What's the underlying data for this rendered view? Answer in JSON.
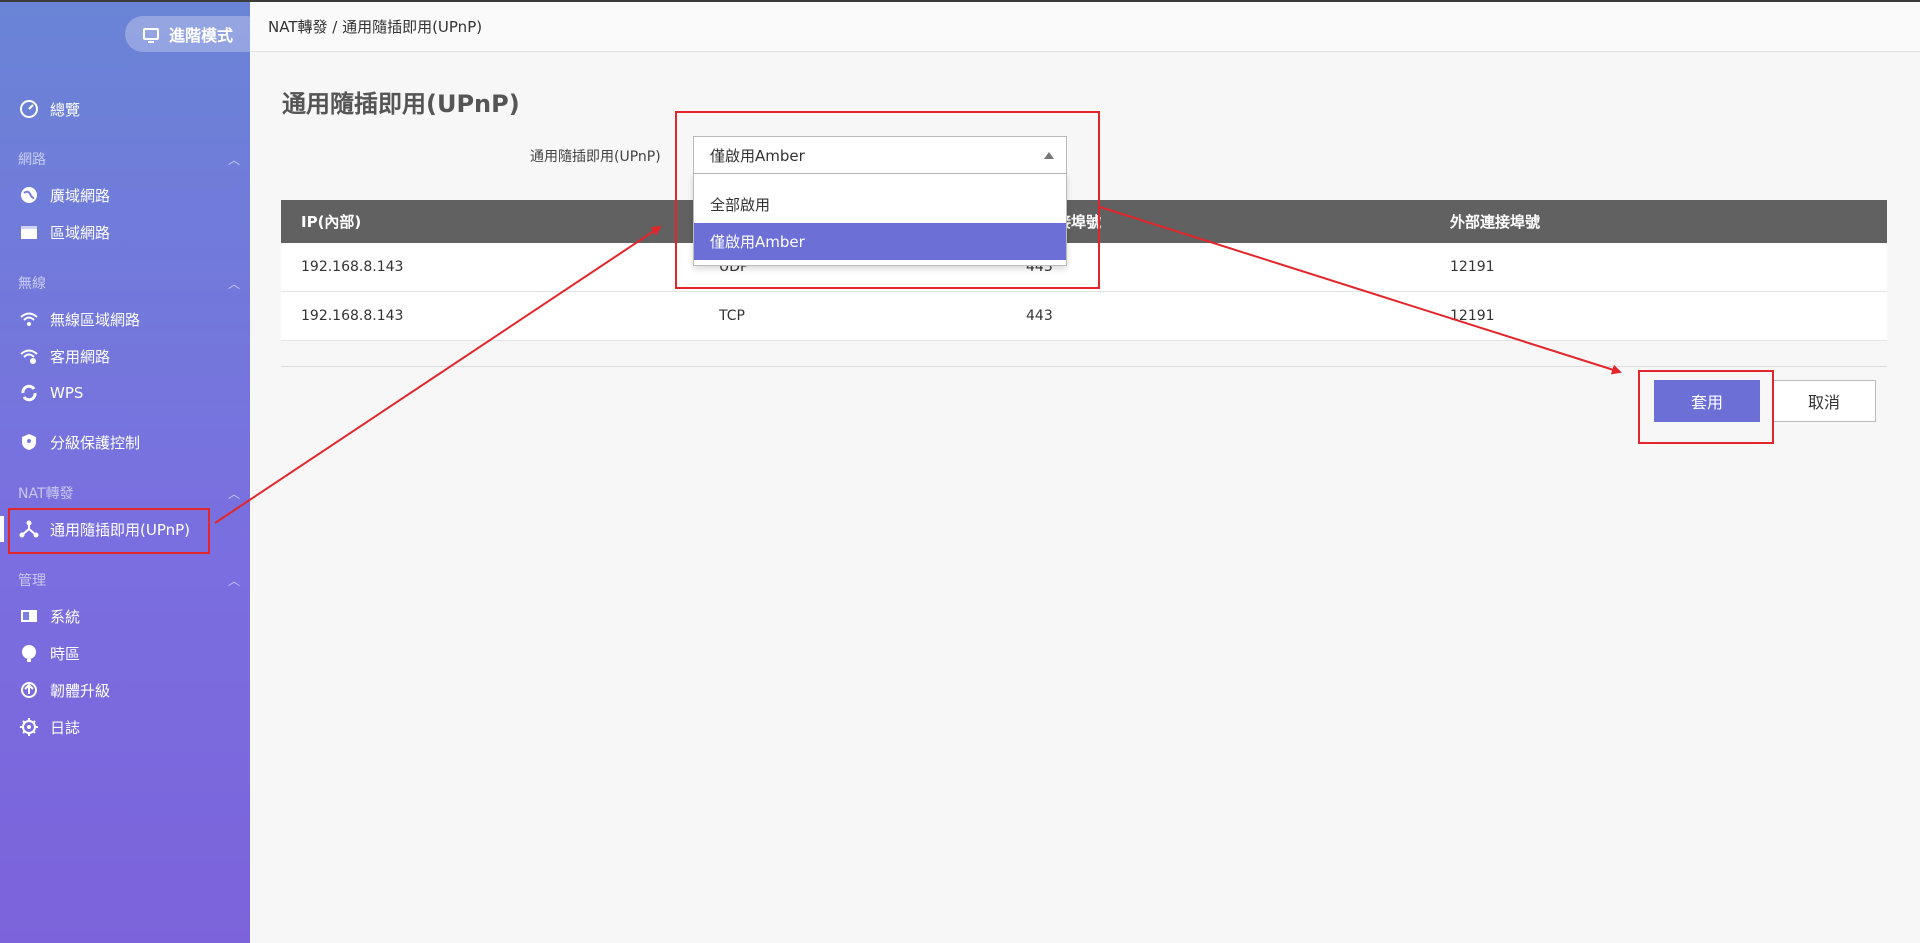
{
  "header": {
    "mode_label": "進階模式",
    "breadcrumb": "NAT轉發 / 通用隨插即用(UPnP)"
  },
  "sidebar": {
    "overview": "總覽",
    "sections": {
      "network": "網路",
      "wireless": "無線",
      "nat": "NAT轉發",
      "management": "管理"
    },
    "items": {
      "wan": "廣域網路",
      "lan": "區域網路",
      "wlan": "無線區域網路",
      "guest": "客用網路",
      "wps": "WPS",
      "parental": "分級保護控制",
      "upnp": "通用隨插即用(UPnP)",
      "system": "系統",
      "timezone": "時區",
      "firmware": "韌體升級",
      "log": "日誌"
    }
  },
  "main": {
    "title": "通用隨插即用(UPnP)",
    "field_label": "通用隨插即用(UPnP)",
    "select_value": "僅啟用Amber",
    "options": [
      "全部啟用",
      "僅啟用Amber"
    ],
    "table": {
      "headers": [
        "IP(內部)",
        "",
        "部連接埠號",
        "外部連接埠號"
      ],
      "rows": [
        [
          "192.168.8.143",
          "UDP",
          "443",
          "12191"
        ],
        [
          "192.168.8.143",
          "TCP",
          "443",
          "12191"
        ]
      ]
    },
    "apply_label": "套用",
    "cancel_label": "取消"
  },
  "colors": {
    "accent": "#6b6fd6",
    "table_header": "#616161",
    "annotation": "#e3262b"
  }
}
